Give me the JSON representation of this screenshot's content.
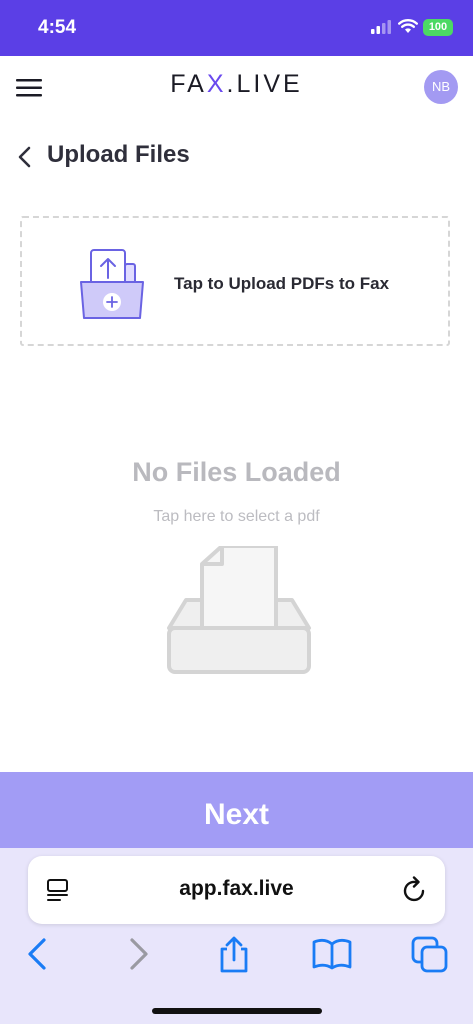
{
  "status_bar": {
    "time": "4:54",
    "battery": "100"
  },
  "header": {
    "logo_prefix": "FA",
    "logo_x": "X",
    "logo_suffix": ".LIVE",
    "avatar_initials": "NB"
  },
  "page": {
    "title": "Upload Files"
  },
  "upload": {
    "label": "Tap to Upload PDFs to Fax"
  },
  "empty_state": {
    "title": "No Files Loaded",
    "subtitle": "Tap here to select a pdf"
  },
  "next_button": {
    "label": "Next"
  },
  "browser": {
    "url": "app.fax.live"
  },
  "colors": {
    "brand": "#5b3fe6",
    "next_bg": "#a29cf5",
    "browser_bg": "#e8e5fb",
    "ios_blue": "#1a7cf5"
  }
}
